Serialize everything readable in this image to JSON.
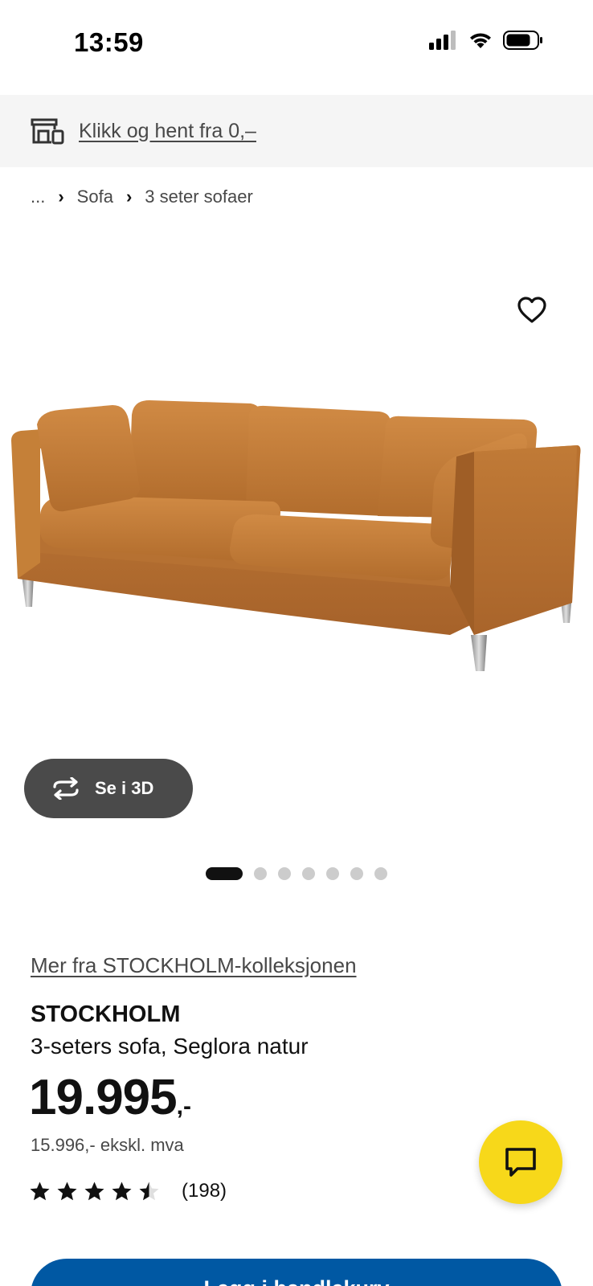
{
  "status_bar": {
    "time": "13:59"
  },
  "pickup_banner": {
    "label": "Klikk og hent fra 0,–"
  },
  "breadcrumb": {
    "ellipsis": "...",
    "items": [
      "Sofa",
      "3 seter sofaer"
    ]
  },
  "media": {
    "view_3d_label": "Se i 3D",
    "gallery_count": 7,
    "gallery_active_index": 0
  },
  "product": {
    "collection_link": "Mer fra STOCKHOLM-kolleksjonen",
    "name": "STOCKHOLM",
    "description": "3-seters sofa, Seglora natur",
    "price_main": "19.995",
    "price_suffix": ",-",
    "price_ex_vat": "15.996,- ekskl. mva",
    "rating_value": 4.5,
    "rating_count": "(198)"
  },
  "actions": {
    "cart_label": "Legg i handlekurv"
  },
  "colors": {
    "cart_blue": "#0058a3",
    "chat_yellow": "#f7d81a",
    "sofa_leather": "#c07a36"
  }
}
